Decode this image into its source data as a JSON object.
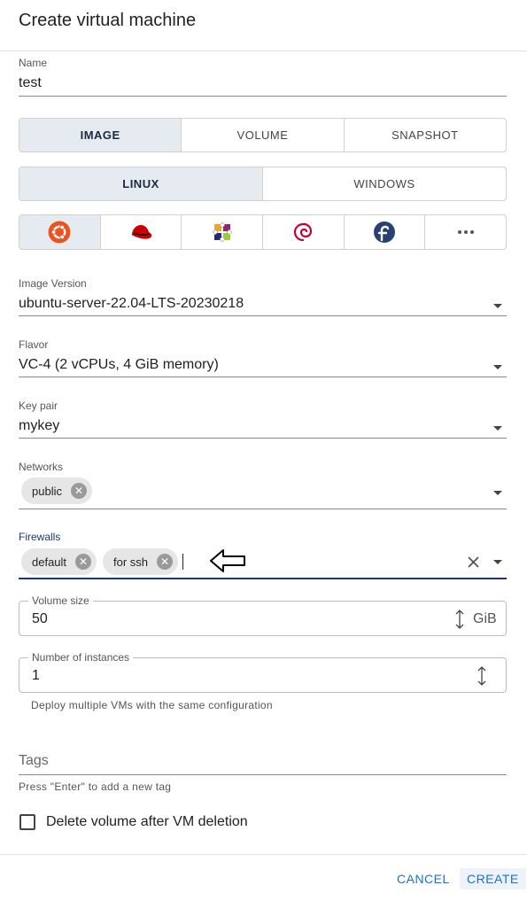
{
  "dialog": {
    "title": "Create virtual machine"
  },
  "name_field": {
    "label": "Name",
    "value": "test"
  },
  "source_tabs": [
    "IMAGE",
    "VOLUME",
    "SNAPSHOT"
  ],
  "os_tabs": [
    "LINUX",
    "WINDOWS"
  ],
  "distros": [
    "ubuntu-icon",
    "redhat-icon",
    "centos-icon",
    "debian-icon",
    "fedora-icon",
    "more-icon"
  ],
  "image_version": {
    "label": "Image Version",
    "value": "ubuntu-server-22.04-LTS-20230218"
  },
  "flavor": {
    "label": "Flavor",
    "value": "VC-4 (2 vCPUs, 4 GiB memory)"
  },
  "key_pair": {
    "label": "Key pair",
    "value": "mykey"
  },
  "networks": {
    "label": "Networks",
    "chips": [
      "public"
    ]
  },
  "firewalls": {
    "label": "Firewalls",
    "chips": [
      "default",
      "for ssh"
    ]
  },
  "volume_size": {
    "label": "Volume size",
    "value": "50",
    "unit": "GiB"
  },
  "instances": {
    "label": "Number of instances",
    "value": "1",
    "helper": "Deploy multiple VMs with the same configuration"
  },
  "tags": {
    "placeholder": "Tags",
    "helper": "Press \"Enter\" to add a new tag"
  },
  "delete_volume": {
    "label": "Delete volume after VM deletion",
    "checked": false
  },
  "footer": {
    "cancel": "CANCEL",
    "create": "CREATE"
  },
  "colors": {
    "accent": "#1a6fd6",
    "active_segment": "#e6ebf1",
    "focus_label": "#1b3a6b"
  }
}
